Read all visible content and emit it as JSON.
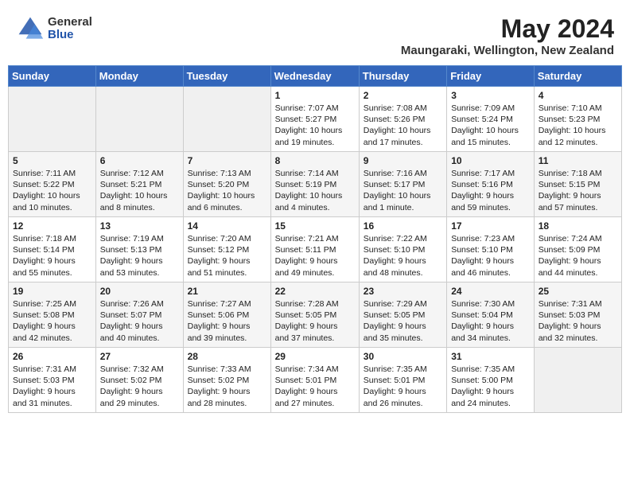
{
  "logo": {
    "general": "General",
    "blue": "Blue"
  },
  "title": "May 2024",
  "location": "Maungaraki, Wellington, New Zealand",
  "weekdays": [
    "Sunday",
    "Monday",
    "Tuesday",
    "Wednesday",
    "Thursday",
    "Friday",
    "Saturday"
  ],
  "weeks": [
    [
      {
        "day": "",
        "info": ""
      },
      {
        "day": "",
        "info": ""
      },
      {
        "day": "",
        "info": ""
      },
      {
        "day": "1",
        "info": "Sunrise: 7:07 AM\nSunset: 5:27 PM\nDaylight: 10 hours\nand 19 minutes."
      },
      {
        "day": "2",
        "info": "Sunrise: 7:08 AM\nSunset: 5:26 PM\nDaylight: 10 hours\nand 17 minutes."
      },
      {
        "day": "3",
        "info": "Sunrise: 7:09 AM\nSunset: 5:24 PM\nDaylight: 10 hours\nand 15 minutes."
      },
      {
        "day": "4",
        "info": "Sunrise: 7:10 AM\nSunset: 5:23 PM\nDaylight: 10 hours\nand 12 minutes."
      }
    ],
    [
      {
        "day": "5",
        "info": "Sunrise: 7:11 AM\nSunset: 5:22 PM\nDaylight: 10 hours\nand 10 minutes."
      },
      {
        "day": "6",
        "info": "Sunrise: 7:12 AM\nSunset: 5:21 PM\nDaylight: 10 hours\nand 8 minutes."
      },
      {
        "day": "7",
        "info": "Sunrise: 7:13 AM\nSunset: 5:20 PM\nDaylight: 10 hours\nand 6 minutes."
      },
      {
        "day": "8",
        "info": "Sunrise: 7:14 AM\nSunset: 5:19 PM\nDaylight: 10 hours\nand 4 minutes."
      },
      {
        "day": "9",
        "info": "Sunrise: 7:16 AM\nSunset: 5:17 PM\nDaylight: 10 hours\nand 1 minute."
      },
      {
        "day": "10",
        "info": "Sunrise: 7:17 AM\nSunset: 5:16 PM\nDaylight: 9 hours\nand 59 minutes."
      },
      {
        "day": "11",
        "info": "Sunrise: 7:18 AM\nSunset: 5:15 PM\nDaylight: 9 hours\nand 57 minutes."
      }
    ],
    [
      {
        "day": "12",
        "info": "Sunrise: 7:18 AM\nSunset: 5:14 PM\nDaylight: 9 hours\nand 55 minutes."
      },
      {
        "day": "13",
        "info": "Sunrise: 7:19 AM\nSunset: 5:13 PM\nDaylight: 9 hours\nand 53 minutes."
      },
      {
        "day": "14",
        "info": "Sunrise: 7:20 AM\nSunset: 5:12 PM\nDaylight: 9 hours\nand 51 minutes."
      },
      {
        "day": "15",
        "info": "Sunrise: 7:21 AM\nSunset: 5:11 PM\nDaylight: 9 hours\nand 49 minutes."
      },
      {
        "day": "16",
        "info": "Sunrise: 7:22 AM\nSunset: 5:10 PM\nDaylight: 9 hours\nand 48 minutes."
      },
      {
        "day": "17",
        "info": "Sunrise: 7:23 AM\nSunset: 5:10 PM\nDaylight: 9 hours\nand 46 minutes."
      },
      {
        "day": "18",
        "info": "Sunrise: 7:24 AM\nSunset: 5:09 PM\nDaylight: 9 hours\nand 44 minutes."
      }
    ],
    [
      {
        "day": "19",
        "info": "Sunrise: 7:25 AM\nSunset: 5:08 PM\nDaylight: 9 hours\nand 42 minutes."
      },
      {
        "day": "20",
        "info": "Sunrise: 7:26 AM\nSunset: 5:07 PM\nDaylight: 9 hours\nand 40 minutes."
      },
      {
        "day": "21",
        "info": "Sunrise: 7:27 AM\nSunset: 5:06 PM\nDaylight: 9 hours\nand 39 minutes."
      },
      {
        "day": "22",
        "info": "Sunrise: 7:28 AM\nSunset: 5:05 PM\nDaylight: 9 hours\nand 37 minutes."
      },
      {
        "day": "23",
        "info": "Sunrise: 7:29 AM\nSunset: 5:05 PM\nDaylight: 9 hours\nand 35 minutes."
      },
      {
        "day": "24",
        "info": "Sunrise: 7:30 AM\nSunset: 5:04 PM\nDaylight: 9 hours\nand 34 minutes."
      },
      {
        "day": "25",
        "info": "Sunrise: 7:31 AM\nSunset: 5:03 PM\nDaylight: 9 hours\nand 32 minutes."
      }
    ],
    [
      {
        "day": "26",
        "info": "Sunrise: 7:31 AM\nSunset: 5:03 PM\nDaylight: 9 hours\nand 31 minutes."
      },
      {
        "day": "27",
        "info": "Sunrise: 7:32 AM\nSunset: 5:02 PM\nDaylight: 9 hours\nand 29 minutes."
      },
      {
        "day": "28",
        "info": "Sunrise: 7:33 AM\nSunset: 5:02 PM\nDaylight: 9 hours\nand 28 minutes."
      },
      {
        "day": "29",
        "info": "Sunrise: 7:34 AM\nSunset: 5:01 PM\nDaylight: 9 hours\nand 27 minutes."
      },
      {
        "day": "30",
        "info": "Sunrise: 7:35 AM\nSunset: 5:01 PM\nDaylight: 9 hours\nand 26 minutes."
      },
      {
        "day": "31",
        "info": "Sunrise: 7:35 AM\nSunset: 5:00 PM\nDaylight: 9 hours\nand 24 minutes."
      },
      {
        "day": "",
        "info": ""
      }
    ]
  ]
}
